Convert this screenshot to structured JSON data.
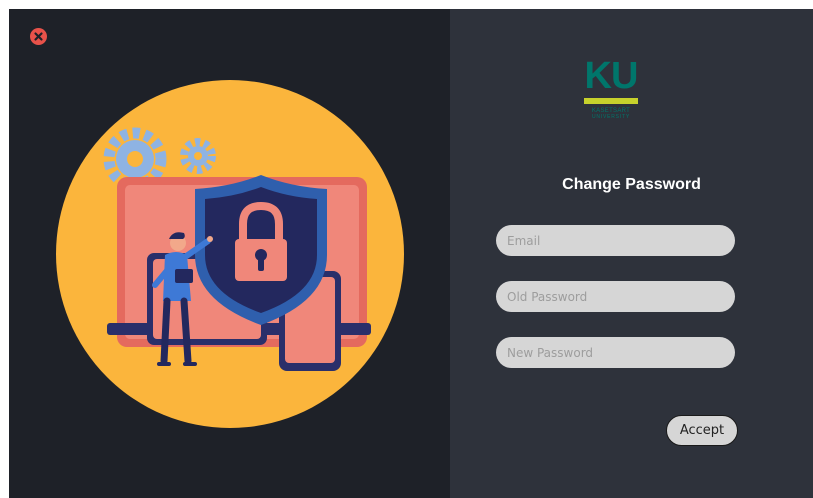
{
  "window": {
    "close_icon": "close-icon"
  },
  "logo": {
    "text": "KU",
    "line1": "KASETSART",
    "line2": "UNIVERSITY"
  },
  "form": {
    "title": "Change Password",
    "email_placeholder": "Email",
    "old_password_placeholder": "Old Password",
    "new_password_placeholder": "New Password",
    "accept_label": "Accept"
  },
  "colors": {
    "left_panel_bg": "#1e2128",
    "right_panel_bg": "#2e323b",
    "close_red": "#e8524a",
    "illustration_circle": "#fbb53c",
    "monitor_pink": "#f0877a",
    "shield_blue": "#2f5fad",
    "logo_green": "#00766b",
    "logo_yellow": "#c7d22c",
    "input_bg": "#d6d6d6"
  }
}
